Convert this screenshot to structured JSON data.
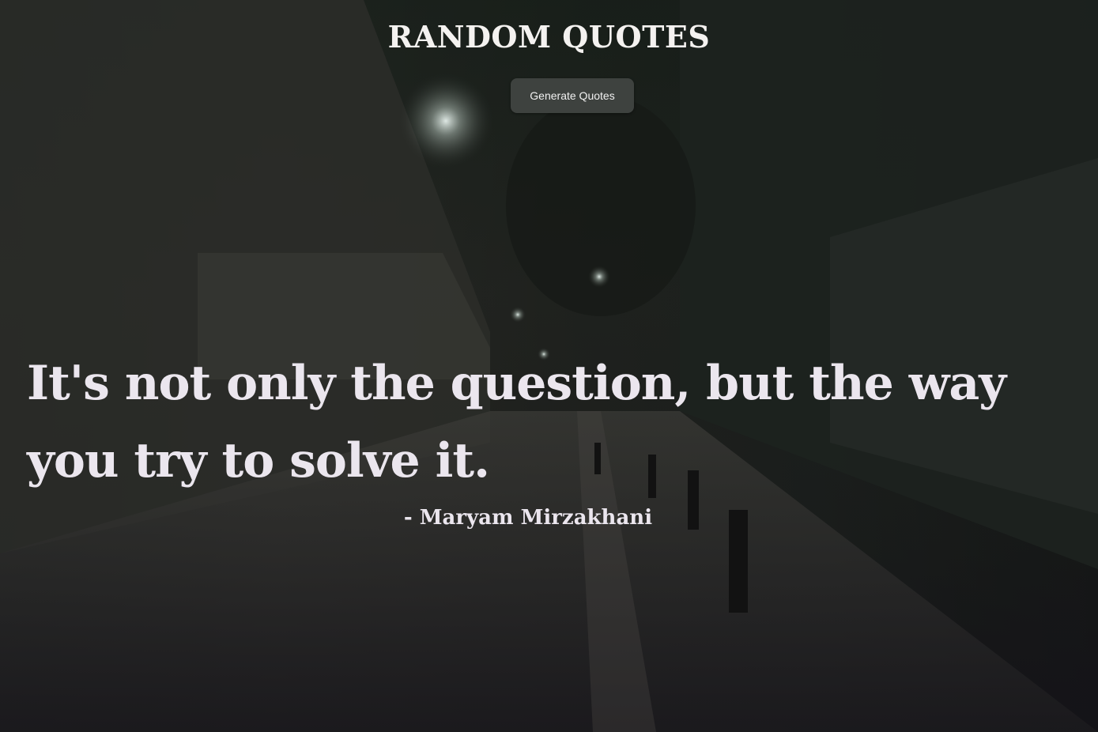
{
  "header": {
    "title": "RANDOM QUOTES"
  },
  "controls": {
    "generate_label": "Generate Quotes"
  },
  "quote": {
    "text": "It's not only the question, but the way you try to solve it.",
    "author": "- Maryam Mirzakhani"
  },
  "colors": {
    "text": "#ebe6ee",
    "button_bg": "#3e423f",
    "button_text": "#f1f1f1"
  }
}
